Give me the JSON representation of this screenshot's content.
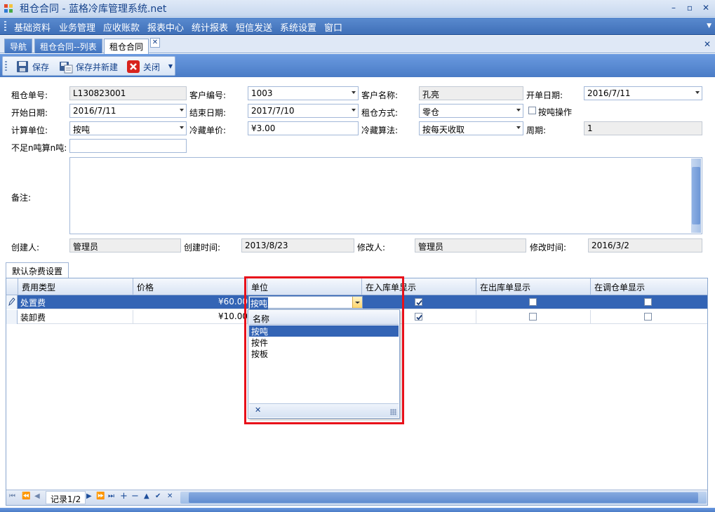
{
  "window": {
    "title": "租仓合同 - 蓝格冷库管理系统.net",
    "controls": [
      "–",
      "▫",
      "✕"
    ]
  },
  "menu": [
    "基础资料",
    "业务管理",
    "应收账款",
    "报表中心",
    "统计报表",
    "短信发送",
    "系统设置",
    "窗口"
  ],
  "tabs": [
    {
      "label": "导航"
    },
    {
      "label": "租仓合同--列表"
    },
    {
      "label": "租仓合同"
    }
  ],
  "toolbar": {
    "save": "保存",
    "save_new": "保存并新建",
    "close": "关闭"
  },
  "form": {
    "contract_no": {
      "label": "租仓单号:",
      "value": "L130823001"
    },
    "customer_code": {
      "label": "客户编号:",
      "value": "1003"
    },
    "customer_name": {
      "label": "客户名称:",
      "value": "孔亮"
    },
    "order_date": {
      "label": "开单日期:",
      "value": "2016/7/11"
    },
    "start_date": {
      "label": "开始日期:",
      "value": "2016/7/11"
    },
    "end_date": {
      "label": "结束日期:",
      "value": "2017/7/10"
    },
    "rent_mode": {
      "label": "租仓方式:",
      "value": "零仓"
    },
    "by_ton_op": {
      "label": "按吨操作",
      "checked": false
    },
    "calc_unit": {
      "label": "计算单位:",
      "value": "按吨"
    },
    "cold_price": {
      "label": "冷藏单价:",
      "value": "¥3.00"
    },
    "cold_method": {
      "label": "冷藏算法:",
      "value": "按每天收取"
    },
    "period": {
      "label": "周期:",
      "value": "1"
    },
    "min_ton": {
      "label": "不足n吨算n吨:",
      "value": ""
    },
    "remark": {
      "label": "备注:",
      "value": ""
    },
    "creator": {
      "label": "创建人:",
      "value": "管理员"
    },
    "create_time": {
      "label": "创建时间:",
      "value": "2013/8/23"
    },
    "modifier": {
      "label": "修改人:",
      "value": "管理员"
    },
    "modify_time": {
      "label": "修改时间:",
      "value": "2016/3/2"
    }
  },
  "fee_tab": "默认杂费设置",
  "grid": {
    "columns": [
      "费用类型",
      "价格",
      "单位",
      "在入库单显示",
      "在出库单显示",
      "在调仓单显示"
    ],
    "rows": [
      {
        "type": "处置费",
        "price": "¥60.00",
        "unit": "按吨",
        "in": true,
        "out": false,
        "transfer": false
      },
      {
        "type": "装卸费",
        "price": "¥10.00",
        "unit": "",
        "in": true,
        "out": false,
        "transfer": false
      }
    ]
  },
  "unit_popup": {
    "header": "名称",
    "items": [
      "按吨",
      "按件",
      "按板"
    ],
    "selected": 0
  },
  "navigator": {
    "record_text": "记录1/2"
  },
  "colors": {
    "accent": "#3364b5",
    "highlight_box": "#e8101a"
  }
}
